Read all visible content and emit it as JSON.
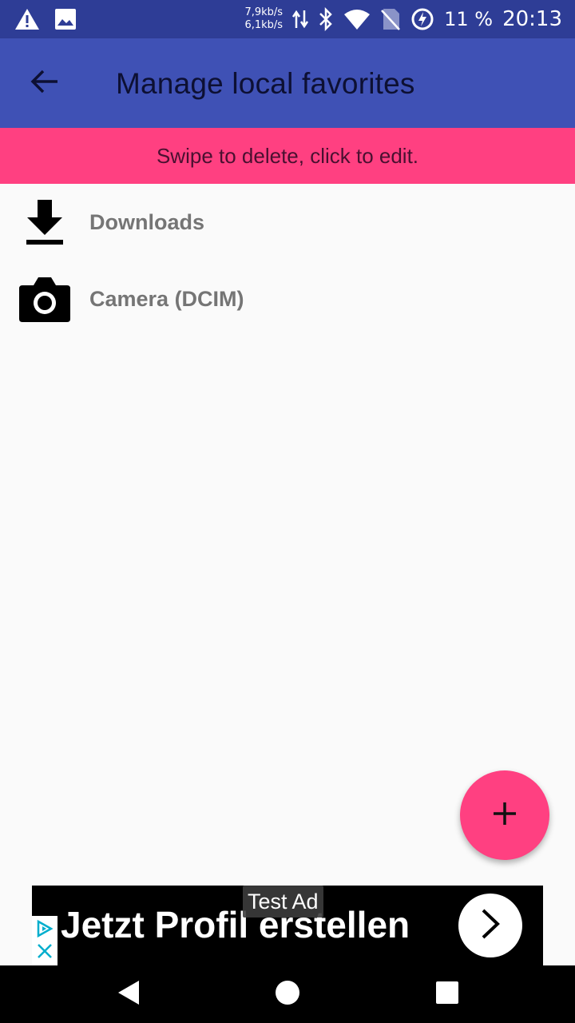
{
  "status_bar": {
    "speed_up": "7,9kb/s",
    "speed_down": "6,1kb/s",
    "battery_percent": "11 %",
    "time": "20:13",
    "icons": [
      "warning-icon",
      "image-icon",
      "data-transfer-icon",
      "bluetooth-icon",
      "wifi-icon",
      "no-sim-icon",
      "battery-charging-icon"
    ]
  },
  "app_bar": {
    "title": "Manage local favorites",
    "back_icon": "arrow-back-icon",
    "color": "#3f51b5"
  },
  "hint": {
    "text": "Swipe to delete, click to edit.",
    "color": "#ff4081"
  },
  "favorites": [
    {
      "label": "Downloads",
      "icon": "download-icon"
    },
    {
      "label": "Camera (DCIM)",
      "icon": "camera-icon"
    }
  ],
  "fab": {
    "icon": "plus-icon",
    "color": "#ff4081"
  },
  "ad": {
    "badge": "Test Ad",
    "headline": "Jetzt Profil erstellen",
    "cta_icon": "chevron-right-icon",
    "info_icons": [
      "adchoices-icon",
      "close-icon"
    ]
  },
  "nav_bar": {
    "icons": [
      "back-triangle-icon",
      "home-circle-icon",
      "recents-square-icon"
    ]
  }
}
